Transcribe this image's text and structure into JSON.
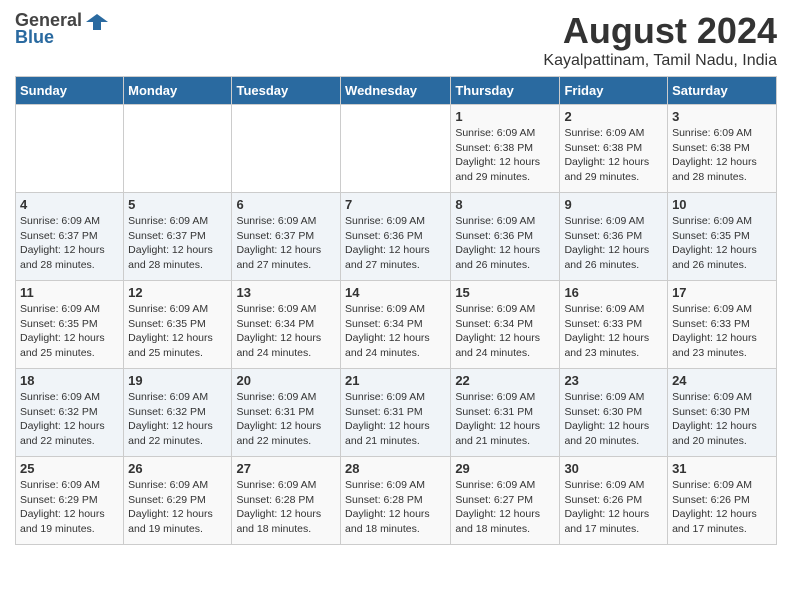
{
  "header": {
    "logo_general": "General",
    "logo_blue": "Blue",
    "title": "August 2024",
    "subtitle": "Kayalpattinam, Tamil Nadu, India"
  },
  "calendar": {
    "days": [
      "Sunday",
      "Monday",
      "Tuesday",
      "Wednesday",
      "Thursday",
      "Friday",
      "Saturday"
    ],
    "weeks": [
      [
        {
          "day": "",
          "info": ""
        },
        {
          "day": "",
          "info": ""
        },
        {
          "day": "",
          "info": ""
        },
        {
          "day": "",
          "info": ""
        },
        {
          "day": "1",
          "info": "Sunrise: 6:09 AM\nSunset: 6:38 PM\nDaylight: 12 hours\nand 29 minutes."
        },
        {
          "day": "2",
          "info": "Sunrise: 6:09 AM\nSunset: 6:38 PM\nDaylight: 12 hours\nand 29 minutes."
        },
        {
          "day": "3",
          "info": "Sunrise: 6:09 AM\nSunset: 6:38 PM\nDaylight: 12 hours\nand 28 minutes."
        }
      ],
      [
        {
          "day": "4",
          "info": "Sunrise: 6:09 AM\nSunset: 6:37 PM\nDaylight: 12 hours\nand 28 minutes."
        },
        {
          "day": "5",
          "info": "Sunrise: 6:09 AM\nSunset: 6:37 PM\nDaylight: 12 hours\nand 28 minutes."
        },
        {
          "day": "6",
          "info": "Sunrise: 6:09 AM\nSunset: 6:37 PM\nDaylight: 12 hours\nand 27 minutes."
        },
        {
          "day": "7",
          "info": "Sunrise: 6:09 AM\nSunset: 6:36 PM\nDaylight: 12 hours\nand 27 minutes."
        },
        {
          "day": "8",
          "info": "Sunrise: 6:09 AM\nSunset: 6:36 PM\nDaylight: 12 hours\nand 26 minutes."
        },
        {
          "day": "9",
          "info": "Sunrise: 6:09 AM\nSunset: 6:36 PM\nDaylight: 12 hours\nand 26 minutes."
        },
        {
          "day": "10",
          "info": "Sunrise: 6:09 AM\nSunset: 6:35 PM\nDaylight: 12 hours\nand 26 minutes."
        }
      ],
      [
        {
          "day": "11",
          "info": "Sunrise: 6:09 AM\nSunset: 6:35 PM\nDaylight: 12 hours\nand 25 minutes."
        },
        {
          "day": "12",
          "info": "Sunrise: 6:09 AM\nSunset: 6:35 PM\nDaylight: 12 hours\nand 25 minutes."
        },
        {
          "day": "13",
          "info": "Sunrise: 6:09 AM\nSunset: 6:34 PM\nDaylight: 12 hours\nand 24 minutes."
        },
        {
          "day": "14",
          "info": "Sunrise: 6:09 AM\nSunset: 6:34 PM\nDaylight: 12 hours\nand 24 minutes."
        },
        {
          "day": "15",
          "info": "Sunrise: 6:09 AM\nSunset: 6:34 PM\nDaylight: 12 hours\nand 24 minutes."
        },
        {
          "day": "16",
          "info": "Sunrise: 6:09 AM\nSunset: 6:33 PM\nDaylight: 12 hours\nand 23 minutes."
        },
        {
          "day": "17",
          "info": "Sunrise: 6:09 AM\nSunset: 6:33 PM\nDaylight: 12 hours\nand 23 minutes."
        }
      ],
      [
        {
          "day": "18",
          "info": "Sunrise: 6:09 AM\nSunset: 6:32 PM\nDaylight: 12 hours\nand 22 minutes."
        },
        {
          "day": "19",
          "info": "Sunrise: 6:09 AM\nSunset: 6:32 PM\nDaylight: 12 hours\nand 22 minutes."
        },
        {
          "day": "20",
          "info": "Sunrise: 6:09 AM\nSunset: 6:31 PM\nDaylight: 12 hours\nand 22 minutes."
        },
        {
          "day": "21",
          "info": "Sunrise: 6:09 AM\nSunset: 6:31 PM\nDaylight: 12 hours\nand 21 minutes."
        },
        {
          "day": "22",
          "info": "Sunrise: 6:09 AM\nSunset: 6:31 PM\nDaylight: 12 hours\nand 21 minutes."
        },
        {
          "day": "23",
          "info": "Sunrise: 6:09 AM\nSunset: 6:30 PM\nDaylight: 12 hours\nand 20 minutes."
        },
        {
          "day": "24",
          "info": "Sunrise: 6:09 AM\nSunset: 6:30 PM\nDaylight: 12 hours\nand 20 minutes."
        }
      ],
      [
        {
          "day": "25",
          "info": "Sunrise: 6:09 AM\nSunset: 6:29 PM\nDaylight: 12 hours\nand 19 minutes."
        },
        {
          "day": "26",
          "info": "Sunrise: 6:09 AM\nSunset: 6:29 PM\nDaylight: 12 hours\nand 19 minutes."
        },
        {
          "day": "27",
          "info": "Sunrise: 6:09 AM\nSunset: 6:28 PM\nDaylight: 12 hours\nand 18 minutes."
        },
        {
          "day": "28",
          "info": "Sunrise: 6:09 AM\nSunset: 6:28 PM\nDaylight: 12 hours\nand 18 minutes."
        },
        {
          "day": "29",
          "info": "Sunrise: 6:09 AM\nSunset: 6:27 PM\nDaylight: 12 hours\nand 18 minutes."
        },
        {
          "day": "30",
          "info": "Sunrise: 6:09 AM\nSunset: 6:26 PM\nDaylight: 12 hours\nand 17 minutes."
        },
        {
          "day": "31",
          "info": "Sunrise: 6:09 AM\nSunset: 6:26 PM\nDaylight: 12 hours\nand 17 minutes."
        }
      ]
    ]
  }
}
